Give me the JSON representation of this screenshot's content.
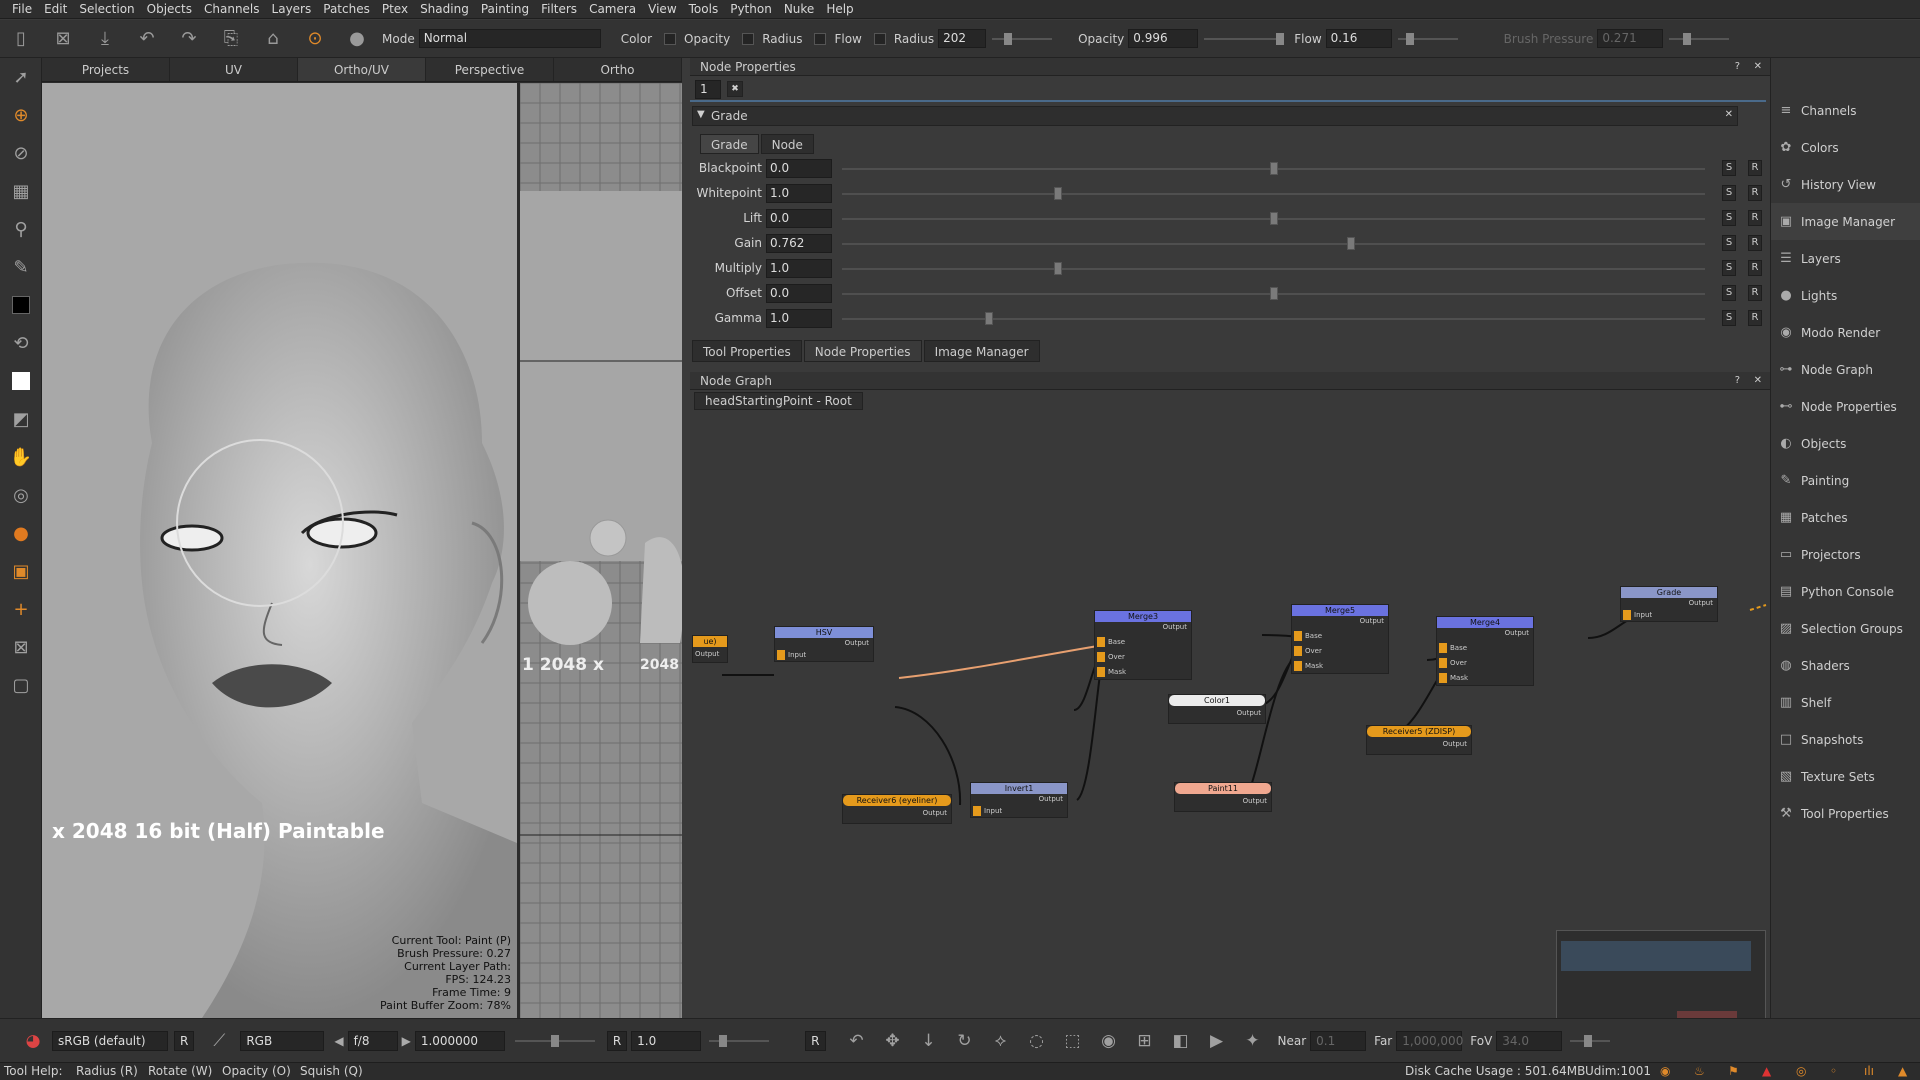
{
  "menu": [
    "File",
    "Edit",
    "Selection",
    "Objects",
    "Channels",
    "Layers",
    "Patches",
    "Ptex",
    "Shading",
    "Painting",
    "Filters",
    "Camera",
    "View",
    "Tools",
    "Python",
    "Nuke",
    "Help"
  ],
  "toolbar": {
    "mode_label": "Mode",
    "mode_value": "Normal",
    "color_label": "Color",
    "opacity_check_label": "Opacity",
    "radius_check_label": "Radius",
    "flow_check_label": "Flow",
    "radius_label": "Radius",
    "radius_value": "202",
    "opacity_label": "Opacity",
    "opacity_value": "0.996",
    "opacity_fraction": 0.996,
    "flow_label": "Flow",
    "flow_value": "0.16",
    "flow_fraction": 0.16,
    "brush_pressure_label": "Brush Pressure",
    "brush_pressure_value": "0.271",
    "brush_pressure_fraction": 0.271
  },
  "viewport": {
    "tabs": [
      "Projects",
      "UV",
      "Ortho/UV",
      "Perspective",
      "Ortho"
    ],
    "active_tab": "Ortho/UV",
    "overlay_text": "x 2048 16 bit (Half) Paintable",
    "uv_overlay_text": "1 2048 x",
    "uv_overlay_text2": "2048",
    "hud": [
      "Current Tool: Paint (P)",
      "Brush Pressure: 0.27",
      "Current Layer Path:",
      "FPS: 124.23",
      "Frame Time: 9",
      "Paint Buffer Zoom: 78%"
    ]
  },
  "node_properties": {
    "title": "Node Properties",
    "count_value": "1",
    "section": "Grade",
    "tabs": [
      "Grade",
      "Node"
    ],
    "params": [
      {
        "label": "Blackpoint",
        "value": "0.0",
        "knob": 0.5
      },
      {
        "label": "Whitepoint",
        "value": "1.0",
        "knob": 0.25
      },
      {
        "label": "Lift",
        "value": "0.0",
        "knob": 0.5
      },
      {
        "label": "Gain",
        "value": "0.762",
        "knob": 0.59
      },
      {
        "label": "Multiply",
        "value": "1.0",
        "knob": 0.25
      },
      {
        "label": "Offset",
        "value": "0.0",
        "knob": 0.5
      },
      {
        "label": "Gamma",
        "value": "1.0",
        "knob": 0.17
      }
    ],
    "s_label": "S",
    "r_label": "R",
    "bottom_tabs": [
      "Tool Properties",
      "Node Properties",
      "Image Manager"
    ],
    "active_bottom_tab": "Node Properties"
  },
  "node_graph": {
    "title": "Node Graph",
    "breadcrumb": "headStartingPoint - Root",
    "nodes": {
      "hsv": "HSV",
      "merge3": "Merge3",
      "merge5": "Merge5",
      "merge4": "Merge4",
      "grade": "Grade",
      "color1": "Color1",
      "invert1": "Invert1",
      "paint11": "Paint11",
      "receiver6": "Receiver6 (eyeliner)",
      "receiver5": "Receiver5 (ZDISP)",
      "left_stub": "ue)",
      "output": "Output",
      "input": "Input",
      "base": "Base",
      "over": "Over",
      "mask": "Mask"
    }
  },
  "right_panel": [
    {
      "label": "Channels",
      "icon": "≡"
    },
    {
      "label": "Colors",
      "icon": "✿"
    },
    {
      "label": "History View",
      "icon": "↺"
    },
    {
      "label": "Image Manager",
      "icon": "▣"
    },
    {
      "label": "Layers",
      "icon": "☰"
    },
    {
      "label": "Lights",
      "icon": "●"
    },
    {
      "label": "Modo Render",
      "icon": "◉"
    },
    {
      "label": "Node Graph",
      "icon": "⊶"
    },
    {
      "label": "Node Properties",
      "icon": "⊷"
    },
    {
      "label": "Objects",
      "icon": "◐"
    },
    {
      "label": "Painting",
      "icon": "✎"
    },
    {
      "label": "Patches",
      "icon": "▦"
    },
    {
      "label": "Projectors",
      "icon": "▭"
    },
    {
      "label": "Python Console",
      "icon": "▤"
    },
    {
      "label": "Selection Groups",
      "icon": "▨"
    },
    {
      "label": "Shaders",
      "icon": "◍"
    },
    {
      "label": "Shelf",
      "icon": "▥"
    },
    {
      "label": "Snapshots",
      "icon": "□"
    },
    {
      "label": "Texture Sets",
      "icon": "▧"
    },
    {
      "label": "Tool Properties",
      "icon": "⚒"
    }
  ],
  "right_panel_active": "Image Manager",
  "bottom": {
    "colorspace": "sRGB (default)",
    "r_label": "R",
    "channels": "RGB",
    "fstop": "f/8",
    "exposure": "1.000000",
    "gain_r": "R",
    "gain": "1.0",
    "gamma_r": "R",
    "near_label": "Near",
    "near_value": "0.1",
    "far_label": "Far",
    "far_value": "1,000,000",
    "fov_label": "FoV",
    "fov_value": "34.0"
  },
  "status": {
    "tool_help": "Tool Help:",
    "hints": [
      "Radius (R)",
      "Rotate (W)",
      "Opacity (O)",
      "Squish (Q)"
    ],
    "disk_cache": "Disk Cache Usage : 501.64MB",
    "udim": "Udim:1001"
  }
}
